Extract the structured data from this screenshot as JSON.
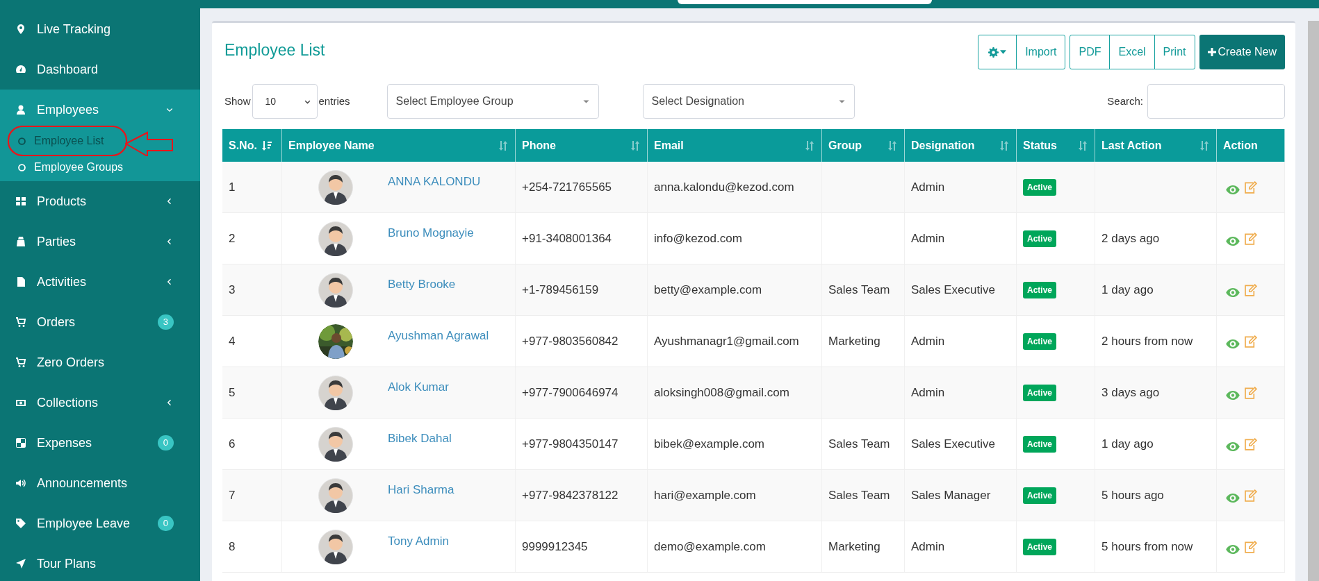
{
  "sidebar": {
    "items": [
      {
        "label": "Live Tracking"
      },
      {
        "label": "Dashboard"
      },
      {
        "label": "Employees",
        "expanded": true,
        "children": [
          {
            "label": "Employee List",
            "selected": true,
            "highlighted": true
          },
          {
            "label": "Employee Groups",
            "selected": false,
            "highlighted": false
          }
        ]
      },
      {
        "label": "Products",
        "expanded": false
      },
      {
        "label": "Parties",
        "expanded": false
      },
      {
        "label": "Activities",
        "expanded": false
      },
      {
        "label": "Orders",
        "badge": "3"
      },
      {
        "label": "Zero Orders"
      },
      {
        "label": "Collections",
        "expanded": false
      },
      {
        "label": "Expenses",
        "badge": "0"
      },
      {
        "label": "Announcements"
      },
      {
        "label": "Employee Leave",
        "badge": "0"
      },
      {
        "label": "Tour Plans"
      }
    ]
  },
  "page": {
    "title": "Employee List",
    "toolbar": {
      "groups": [
        [
          "Import"
        ],
        [
          "PDF",
          "Excel",
          "Print"
        ]
      ],
      "create_button": "Create New"
    },
    "filters": {
      "show_label": "Show",
      "page_size": "10",
      "entries_label": "entries",
      "employee_group": {
        "placeholder": "Select Employee Group"
      },
      "designation": {
        "placeholder": "Select Designation"
      },
      "search_label": "Search:"
    },
    "table": {
      "columns": [
        {
          "label": "S.No.",
          "sortable": true,
          "sorted": true
        },
        {
          "label": "Employee Name",
          "sortable": true,
          "sorted": false
        },
        {
          "label": "Phone",
          "sortable": true,
          "sorted": false
        },
        {
          "label": "Email",
          "sortable": true,
          "sorted": false
        },
        {
          "label": "Group",
          "sortable": true,
          "sorted": false
        },
        {
          "label": "Designation",
          "sortable": true,
          "sorted": false
        },
        {
          "label": "Status",
          "sortable": true,
          "sorted": false
        },
        {
          "label": "Last Action",
          "sortable": true,
          "sorted": false
        },
        {
          "label": "Action",
          "sortable": false
        }
      ],
      "rows": [
        {
          "sno": "1",
          "avatar_photo": false,
          "name": "ANNA KALONDU",
          "phone": "+254-721765565",
          "email": "anna.kalondu@kezod.com",
          "designation": "Admin",
          "status": "Active"
        },
        {
          "sno": "2",
          "avatar_photo": false,
          "name": "Bruno Mognayie",
          "phone": "+91-3408001364",
          "email": "info@kezod.com",
          "designation": "Admin",
          "status": "Active",
          "last_action": "2 days ago"
        },
        {
          "sno": "3",
          "avatar_photo": false,
          "name": "Betty Brooke",
          "phone": "+1-789456159",
          "email": "betty@example.com",
          "group": "Sales Team",
          "designation": "Sales Executive",
          "status": "Active",
          "last_action": "1 day ago"
        },
        {
          "sno": "4",
          "avatar_photo": true,
          "name": "Ayushman Agrawal",
          "phone": "+977-9803560842",
          "email": "Ayushmanagr1@gmail.com",
          "group": "Marketing",
          "designation": "Admin",
          "status": "Active",
          "last_action": "2 hours from now"
        },
        {
          "sno": "5",
          "avatar_photo": false,
          "name": "Alok Kumar",
          "phone": "+977-7900646974",
          "email": "aloksingh008@gmail.com",
          "designation": "Admin",
          "status": "Active",
          "last_action": "3 days ago"
        },
        {
          "sno": "6",
          "avatar_photo": false,
          "name": "Bibek Dahal",
          "phone": "+977-9804350147",
          "email": "bibek@example.com",
          "group": "Sales Team",
          "designation": "Sales Executive",
          "status": "Active",
          "last_action": "1 day ago"
        },
        {
          "sno": "7",
          "avatar_photo": false,
          "name": "Hari Sharma",
          "phone": "+977-9842378122",
          "email": "hari@example.com",
          "group": "Sales Team",
          "designation": "Sales Manager",
          "status": "Active",
          "last_action": "5 hours ago"
        },
        {
          "sno": "8",
          "avatar_photo": false,
          "name": "Tony Admin",
          "phone": "9999912345",
          "email": "demo@example.com",
          "group": "Marketing",
          "designation": "Admin",
          "status": "Active",
          "last_action": "5 hours from now"
        }
      ]
    }
  }
}
